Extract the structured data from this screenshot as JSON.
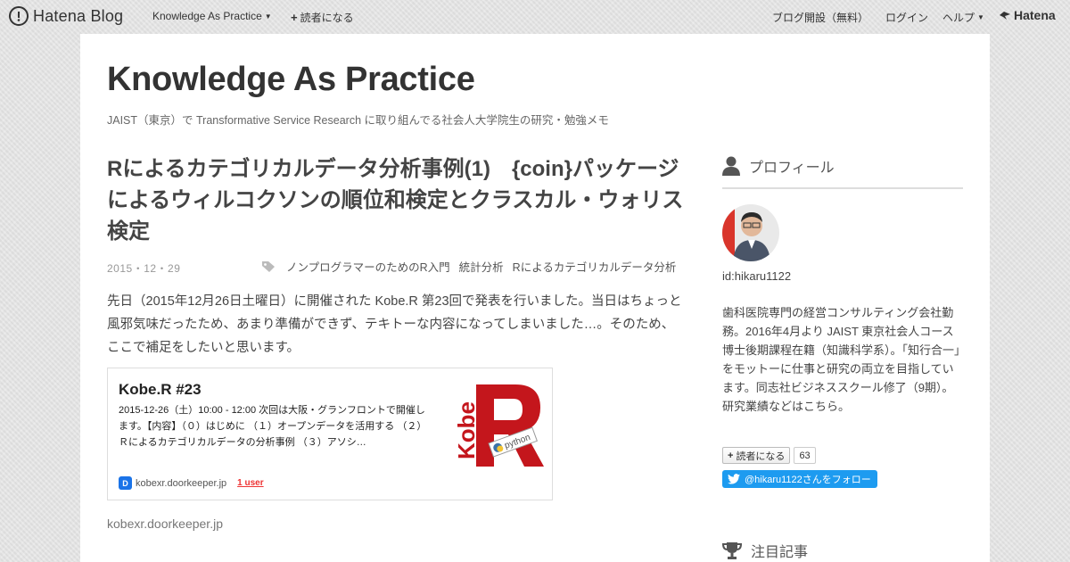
{
  "topbar": {
    "brand": "Hatena Blog",
    "blog_name": "Knowledge As Practice",
    "subscribe": "読者になる",
    "open_blog": "ブログ開設（無料）",
    "login": "ログイン",
    "help": "ヘルプ",
    "hatena": "Hatena"
  },
  "blog": {
    "title": "Knowledge As Practice",
    "description": "JAIST（東京）で Transformative Service Research に取り組んでる社会人大学院生の研究・勉強メモ"
  },
  "entry": {
    "title": "Rによるカテゴリカルデータ分析事例(1)　{coin}パッケージによるウィルコクソンの順位和検定とクラスカル・ウォリス検定",
    "date": "2015・12・29",
    "categories": [
      "ノンプログラマーのためのR入門",
      "統計分析",
      "Rによるカテゴリカルデータ分析"
    ],
    "body": "先日（2015年12月26日土曜日）に開催された Kobe.R 第23回で発表を行いました。当日はちょっと風邪気味だったため、あまり準備ができず、テキトーな内容になってしまいました…。そのため、ここで補足をしたいと思います。",
    "link_text": "kobexr.doorkeeper.jp"
  },
  "card": {
    "title": "Kobe.R #23",
    "description": "2015-12-26（土）10:00 - 12:00 次回は大阪・グランフロントで開催します。【内容】（０）はじめに （１）オープンデータを活用する （２）Ｒによるカテゴリカルデータの分析事例 （３）アソシ…",
    "domain": "kobexr.doorkeeper.jp",
    "users": "1 user",
    "thumb_kobe": "Kobe",
    "thumb_python": "python"
  },
  "sidebar": {
    "profile_heading": "プロフィール",
    "user_id": "id:hikaru1122",
    "description": "歯科医院専門の経営コンサルティング会社勤務。2016年4月より JAIST 東京社会人コース 博士後期課程在籍（知識科学系）。「知行合一」をモットーに仕事と研究の両立を目指しています。同志社ビジネススクール修了（9期）。研究業績などはこちら。",
    "subscribe_label": "読者になる",
    "subscriber_count": "63",
    "twitter_follow": "@hikaru1122さんをフォロー",
    "featured_heading": "注目記事"
  },
  "colors": {
    "accent_red": "#c4161c",
    "twitter_blue": "#1d9bf0"
  }
}
